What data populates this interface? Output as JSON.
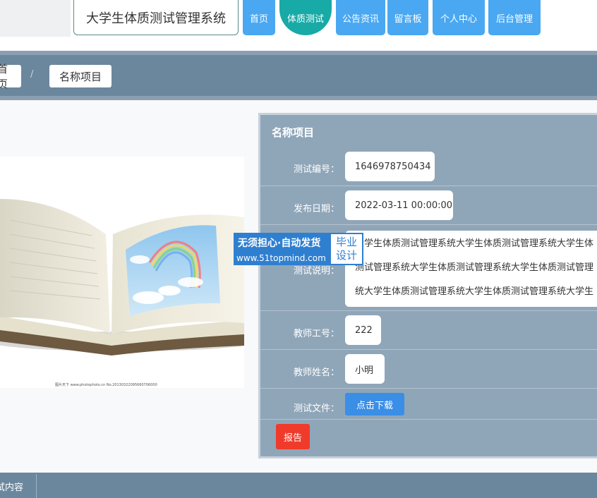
{
  "header": {
    "site_title": "大学生体质测试管理系统",
    "nav": [
      {
        "label": "首页"
      },
      {
        "label": "体质测试",
        "active": true
      },
      {
        "label": "公告资讯"
      },
      {
        "label": "留言板"
      },
      {
        "label": "个人中心"
      },
      {
        "label": "后台管理"
      }
    ]
  },
  "breadcrumb": {
    "home": "首页",
    "separator": "/",
    "current": "名称项目"
  },
  "detail": {
    "title": "名称项目",
    "fields": [
      {
        "label": "测试编号：",
        "value": "1646978750434"
      },
      {
        "label": "发布日期：",
        "value": "2022-03-11 00:00:00"
      },
      {
        "label": "测试说明：",
        "lines": [
          "大学生体质测试管理系统大学生体质测试管理系统大学生体",
          "测试管理系统大学生体质测试管理系统大学生体质测试管理",
          "统大学生体质测试管理系统大学生体质测试管理系统大学生"
        ]
      },
      {
        "label": "教师工号：",
        "value": "222"
      },
      {
        "label": "教师姓名：",
        "value": "小明"
      },
      {
        "label": "测试文件：",
        "button": "点击下载"
      }
    ],
    "report_button": "报告"
  },
  "watermark": {
    "line1": "无须担心·自动发货",
    "line2": "www.51topmind.com",
    "badge_line1": "毕业",
    "badge_line2": "设计"
  },
  "image_caption": "图片天下 www.photophoto.cn  No.20130322095660706000",
  "footer": {
    "tab": "测试内容"
  },
  "colors": {
    "nav_blue": "#4aa8f2",
    "nav_active": "#17aaa6",
    "band": "#6b879e",
    "panel": "#8fa6b9",
    "download": "#3a8ee6",
    "report": "#f03a2a"
  }
}
